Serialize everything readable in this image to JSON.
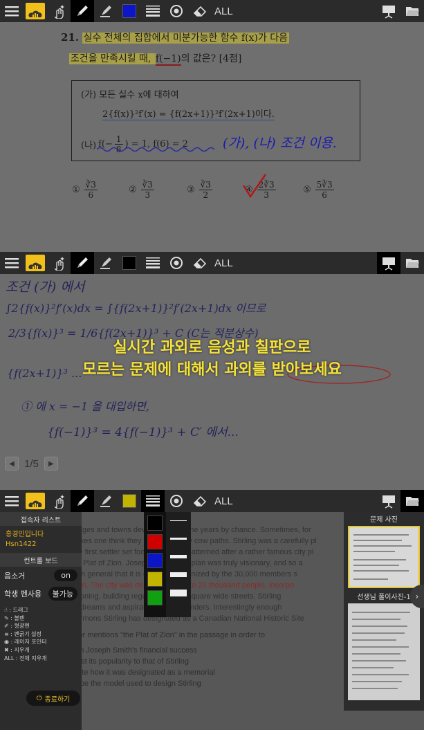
{
  "toolbar": {
    "all_label": "ALL",
    "icons": [
      "menu-icon",
      "cloud-icon",
      "gesture-icon",
      "pen-icon",
      "highlighter-icon",
      "color-icon",
      "line-width-icon",
      "laser-pointer-icon",
      "eraser-icon",
      "presentation-icon",
      "folder-icon"
    ],
    "colors": {
      "toolbar1_color": "#0c16c8",
      "toolbar2_color": "#000000",
      "toolbar3_color": "#c2b400",
      "accent": "#f2c01a"
    }
  },
  "problem": {
    "number": "21.",
    "line1": "실수 전체의 집합에서 미분가능한 함수 f(x)가 다음",
    "line2_a": "조건을 만족시킬 때, ",
    "line2_b": "f(−1)",
    "line2_c": "의 값은? [4점]",
    "cond_a_label": "(가) 모든 실수 x에 대하여",
    "cond_a_formula": "2{f(x)}²f′(x) = {f(2x+1)}²f′(2x+1)이다.",
    "cond_b_label": "(나)",
    "cond_b_formula_a": "f(−",
    "cond_b_frac_num": "1",
    "cond_b_frac_den": "8",
    "cond_b_formula_b": ") = 1, f(6) = 2",
    "annotation": "(가), (나) 조건 이용.",
    "choices": [
      {
        "mark": "①",
        "num": "∛3",
        "den": "6"
      },
      {
        "mark": "②",
        "num": "∛3",
        "den": "3"
      },
      {
        "mark": "③",
        "num": "∛3",
        "den": "2"
      },
      {
        "mark": "④",
        "num": "2∛3",
        "den": "3"
      },
      {
        "mark": "⑤",
        "num": "5∛3",
        "den": "6"
      }
    ]
  },
  "board": {
    "line1": "조건 (가) 에서",
    "line2": "∫2{f(x)}²f′(x)dx = ∫{f(2x+1)}²f′(2x+1)dx 이므로",
    "line3": "2/3{f(x)}³ = 1/6{f(2x+1)}³ + C (C는 적분상수)",
    "line4": "{f(2x+1)}³ ...",
    "line5": "① 에 x = −1 을 대입하면,",
    "line6": "{f(−1)}³ = 4{f(−1)}³ + C′ 에서...",
    "page_indicator": "1/5"
  },
  "banner": {
    "line1": "실시간 과외로 음성과 칠판으로",
    "line2": "모르는 문제에 대해서 과외를 받아보세요"
  },
  "session": {
    "attendees_title": "접속자 리스트",
    "user_name": "홍경민입니다",
    "user_id": "Hsn1422",
    "control_title": "컨트롤 보드",
    "mute_label": "음소거",
    "mute_value": "on",
    "student_pen_label": "학생 펜사용",
    "student_pen_value": "불가능",
    "legend": [
      "☝ : 드래그",
      "✎ : 볼펜",
      "✐ : 형광펜",
      "≡ : 펜굵기 설정",
      "◉ : 레이저 포인터",
      "✖ : 지우개",
      "ALL : 전체 지우개"
    ],
    "end_label": "종료하기",
    "problem_photo_title": "문제 사진",
    "teacher_photo_title": "선생님 풀이사진-1",
    "palette": [
      "#000000",
      "#d00000",
      "#0c16c8",
      "#c2b400",
      "#10a010"
    ]
  },
  "reading": {
    "p1": "many villages and towns developed over the years by chance. Sometimes, for",
    "p2": "roads makes one think they were originally cow paths. Stirling was a carefully pl",
    "p3": "before the first settler set foot in it. It was patterned after a rather famous city pl",
    "p4": "called the Plat of Zion. Joseph Smith. The plan was truly visionary, and so a",
    "p5": "planning in general that it is officially recognized by the 30,000 members s",
    "p6": "association. The city was designed for 15 to 20 thousand people, incorpo",
    "p7": "modern zoning, building regulations, and square wide streets. Stirling",
    "p8": "meet the dreams and aspirations of its founders. Interestingly enough",
    "p9": "of the Mormons Stirling has designated as a Canadian National Historic Site",
    "question": "The author mentions \"the Plat of Zion\" in the passage in order to",
    "options": [
      "(1)  explain Joseph Smith's financial success",
      "(2)  contrast its popularity to that of Stirling",
      "(3)  illustrate how it was designated as a memorial",
      "(4)  describe the model used to design Stirling"
    ]
  }
}
